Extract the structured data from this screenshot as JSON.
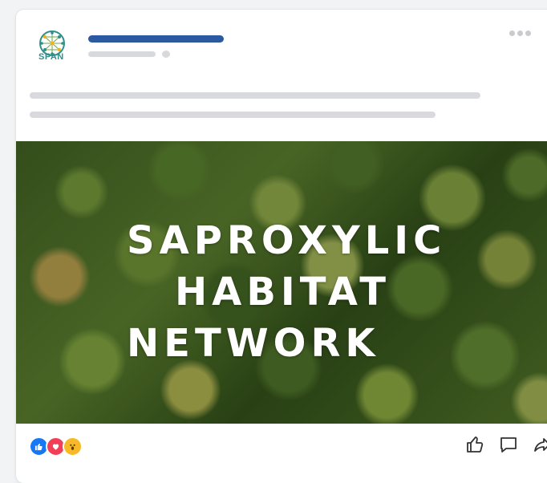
{
  "post": {
    "page_logo_text": "SPAN",
    "image_headline": {
      "line1": "SAPROXYLIC",
      "line2": "HABITAT",
      "line3": "NETWORK"
    }
  },
  "reactions": [
    "like-icon",
    "love-icon",
    "wow-icon"
  ],
  "actions": [
    "like-icon",
    "comment-icon",
    "share-icon"
  ],
  "colors": {
    "name_placeholder": "#2c5aa0",
    "placeholder_gray": "#d9dadd",
    "logo_teal": "#2f8f8a",
    "like_blue": "#1877f2",
    "love_red": "#f33e58",
    "wow_yellow": "#f7b928"
  }
}
